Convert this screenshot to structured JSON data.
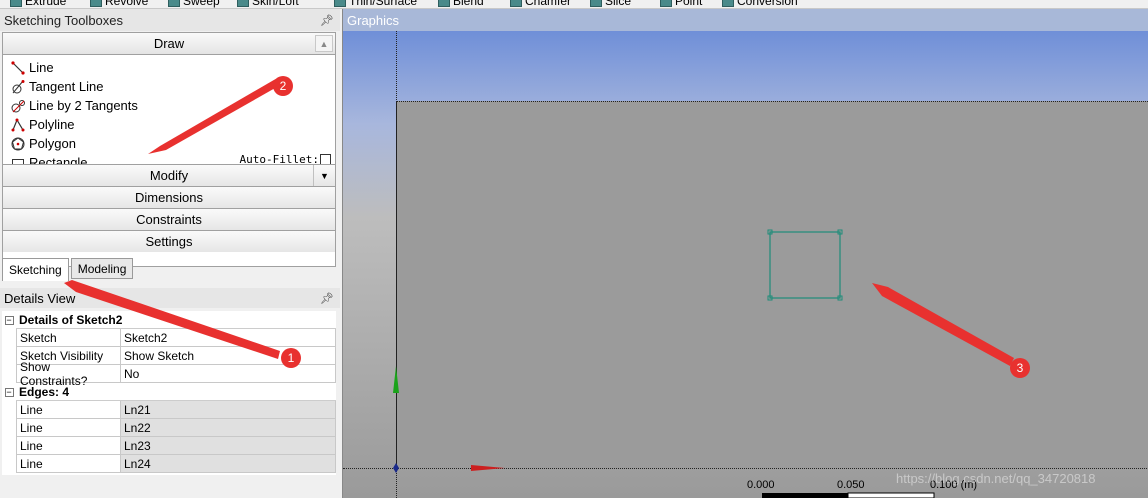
{
  "toolbar": {
    "items": [
      "Extrude",
      "Revolve",
      "Sweep",
      "Skin/Loft",
      "Thin/Surface",
      "Blend",
      "Chamfer",
      "Slice",
      "Point",
      "Conversion"
    ]
  },
  "sketching_toolboxes": {
    "title": "Sketching Toolboxes",
    "draw": {
      "label": "Draw",
      "items": [
        "Line",
        "Tangent Line",
        "Line by 2 Tangents",
        "Polyline",
        "Polygon",
        "Rectangle"
      ],
      "autofillet_label": "Auto-Fillet:"
    },
    "sections": [
      "Modify",
      "Dimensions",
      "Constraints",
      "Settings"
    ]
  },
  "tabs": [
    "Sketching",
    "Modeling"
  ],
  "details_view": {
    "title": "Details View",
    "group1": {
      "label": "Details of Sketch2",
      "rows": [
        {
          "key": "Sketch",
          "value": "Sketch2"
        },
        {
          "key": "Sketch Visibility",
          "value": "Show Sketch"
        },
        {
          "key": "Show Constraints?",
          "value": "No"
        }
      ]
    },
    "group2": {
      "label": "Edges: 4",
      "rows": [
        {
          "key": "Line",
          "value": "Ln21"
        },
        {
          "key": "Line",
          "value": "Ln22"
        },
        {
          "key": "Line",
          "value": "Ln23"
        },
        {
          "key": "Line",
          "value": "Ln24"
        }
      ]
    }
  },
  "graphics": {
    "title": "Graphics",
    "scale_labels": [
      "0.000",
      "0.050",
      "0.100 (m)"
    ],
    "watermark": "https://blog.csdn.net/qq_34720818"
  },
  "annotations": [
    "1",
    "2",
    "3"
  ],
  "colors": {
    "accent": "#e8312f",
    "sketch": "#1e8c7a"
  }
}
